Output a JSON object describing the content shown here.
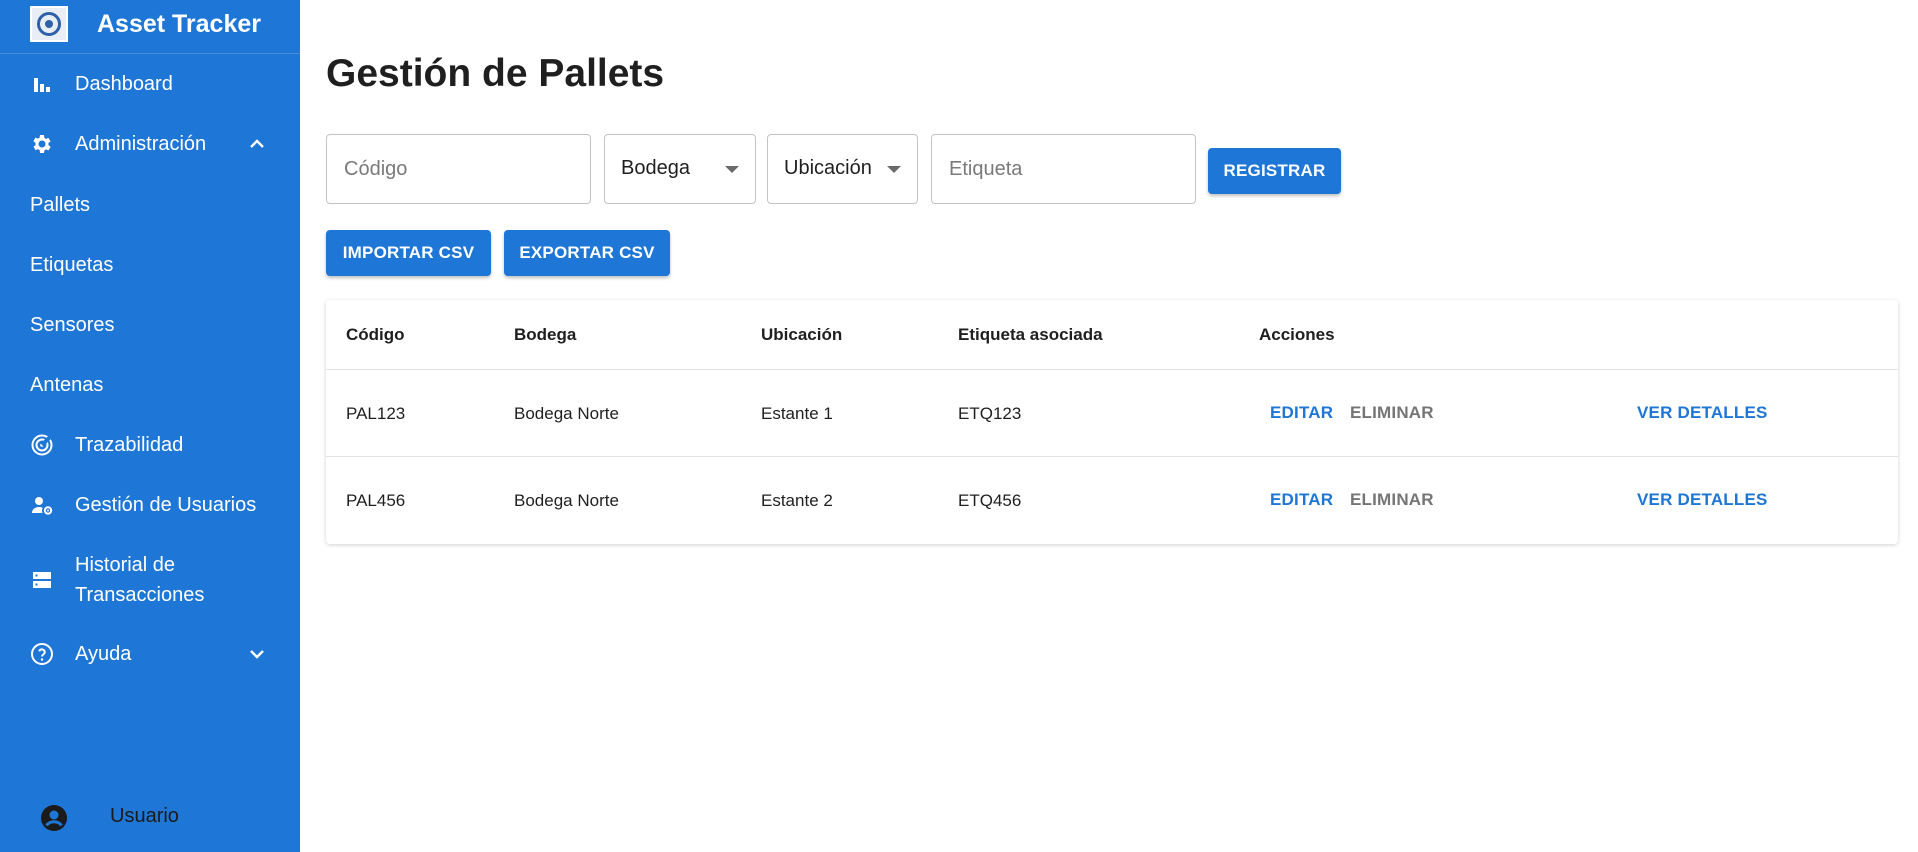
{
  "app": {
    "title": "Asset Tracker"
  },
  "colors": {
    "primary": "#1e76d6",
    "sidebar_text": "#ffffff",
    "muted_action": "#757575"
  },
  "sidebar": {
    "items": [
      {
        "label": "Dashboard",
        "icon": "bar-chart-icon"
      },
      {
        "label": "Administración",
        "icon": "gear-icon",
        "expanded": true
      },
      {
        "label": "Pallets"
      },
      {
        "label": "Etiquetas"
      },
      {
        "label": "Sensores"
      },
      {
        "label": "Antenas"
      },
      {
        "label": "Trazabilidad",
        "icon": "radar-icon"
      },
      {
        "label": "Gestión de Usuarios",
        "icon": "manage-accounts-icon"
      },
      {
        "label": "Historial de Transacciones",
        "icon": "storage-icon"
      },
      {
        "label": "Ayuda",
        "icon": "help-icon",
        "expanded": false
      }
    ],
    "user_label": "Usuario"
  },
  "page": {
    "title": "Gestión de Pallets",
    "form": {
      "codigo_placeholder": "Código",
      "bodega_value": "Bodega",
      "ubicacion_value": "Ubicación",
      "etiqueta_placeholder": "Etiqueta",
      "register_label": "REGISTRAR"
    },
    "import_label": "IMPORTAR CSV",
    "export_label": "EXPORTAR CSV",
    "table": {
      "headers": [
        "Código",
        "Bodega",
        "Ubicación",
        "Etiqueta asociada",
        "Acciones"
      ],
      "rows": [
        {
          "codigo": "PAL123",
          "bodega": "Bodega Norte",
          "ubicacion": "Estante 1",
          "etiqueta": "ETQ123"
        },
        {
          "codigo": "PAL456",
          "bodega": "Bodega Norte",
          "ubicacion": "Estante 2",
          "etiqueta": "ETQ456"
        }
      ],
      "actions": {
        "edit": "EDITAR",
        "delete": "ELIMINAR",
        "details": "VER DETALLES"
      }
    }
  }
}
